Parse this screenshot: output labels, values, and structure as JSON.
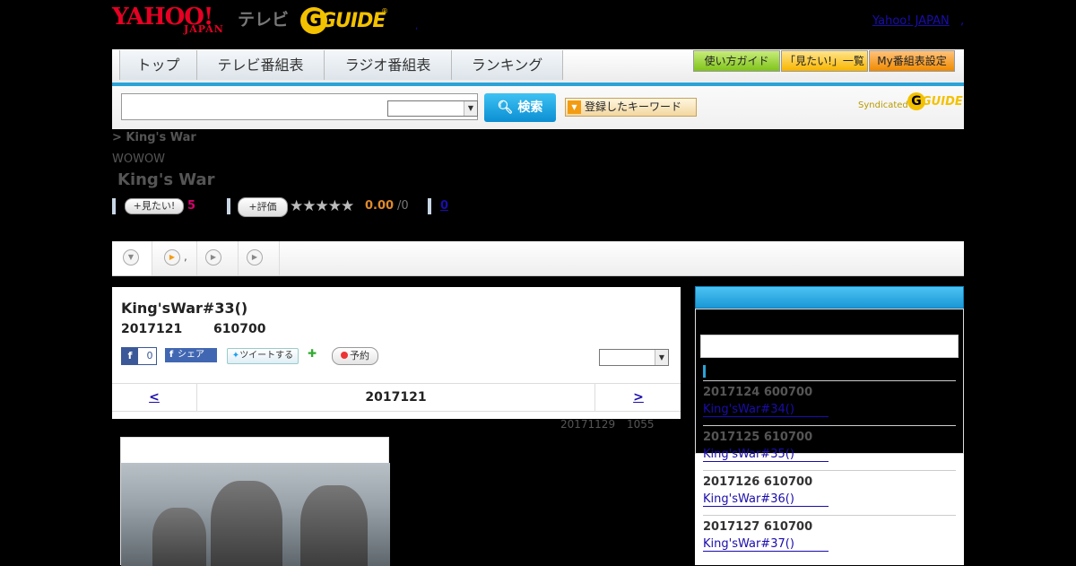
{
  "header": {
    "yahoo_logo": "YAHOO!",
    "yahoo_sub": "JAPAN",
    "tv_label": "テレビ",
    "guide_logo_g": "G",
    "guide_logo_text": "GUIDE",
    "guide_reg": "®",
    "separator": ",",
    "yahoo_japan_link": "Yahoo! JAPAN",
    "yahoo_japan_dot": ","
  },
  "nav": {
    "tabs": [
      "トップ",
      "テレビ番組表",
      "ラジオ番組表",
      "ランキング"
    ],
    "buttons": [
      "使い方ガイド",
      "「見たい!」一覧",
      "My番組表設定"
    ]
  },
  "search": {
    "input_value": "",
    "select_value": "",
    "button_label": "検索",
    "keyword_button": "登録したキーワード",
    "syndicated": "Syndicated",
    "synd_logo_g": "G",
    "synd_logo_text": "GUIDE"
  },
  "program": {
    "breadcrumb": ">  King's War",
    "channel": "WOWOW",
    "title": "King's War",
    "mitai_label": "見たい!",
    "mitai_count": "5",
    "rate_label": "評価",
    "stars": "★★★★★",
    "rating": "0.00",
    "rating_count": "/0",
    "link_count": "0"
  },
  "program_tabs": [
    {
      "label": ""
    },
    {
      "label": ","
    },
    {
      "label": ""
    },
    {
      "label": ""
    }
  ],
  "episode": {
    "title": "King'sWar#33()",
    "date": "2017121",
    "time": "610700",
    "fb_like_count": "0",
    "fb_share": "シェア",
    "tweet": "ツイートする",
    "reserve": "予約",
    "select_value": "",
    "pager_prev": "<",
    "pager_date": "2017121",
    "pager_next": ">",
    "updated_date": "20171129",
    "updated_time": "1055"
  },
  "sidebar": {
    "input_value": "",
    "items": [
      {
        "date": "2017124  600700",
        "link": "King'sWar#34()"
      },
      {
        "date": "2017125  610700",
        "link": "King'sWar#35()"
      },
      {
        "date": "2017126  610700",
        "link": "King'sWar#36()"
      },
      {
        "date": "2017127  610700",
        "link": "King'sWar#37()"
      }
    ]
  },
  "colors": {
    "accent_blue": "#2aa3d8",
    "yahoo_red": "#e60023",
    "guide_yellow": "#f3c100",
    "mitai_pink": "#d6006e",
    "rating_orange": "#e08a2a"
  }
}
